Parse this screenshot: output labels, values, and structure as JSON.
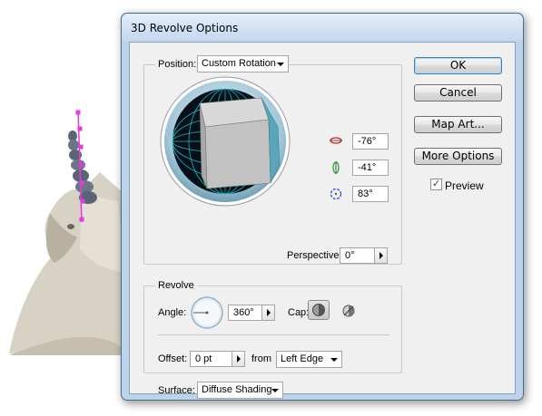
{
  "dialog": {
    "title": "3D Revolve Options",
    "position": {
      "label": "Position:",
      "value": "Custom Rotation"
    },
    "rotation": {
      "x_angle": "-76°",
      "y_angle": "-41°",
      "z_angle": "83°"
    },
    "perspective": {
      "label": "Perspective:",
      "value": "0°"
    },
    "revolve": {
      "legend": "Revolve",
      "angle_label": "Angle:",
      "angle_value": "360°",
      "cap_label": "Cap:",
      "offset_label": "Offset:",
      "offset_value": "0 pt",
      "from_label": "from",
      "from_value": "Left Edge"
    },
    "surface": {
      "label": "Surface:",
      "value": "Diffuse Shading"
    },
    "buttons": {
      "ok": "OK",
      "cancel": "Cancel",
      "map_art": "Map Art...",
      "more_options": "More Options"
    },
    "preview": {
      "label": "Preview",
      "checked": true
    }
  },
  "icons": {
    "x_axis": "x-axis-rotation-icon",
    "y_axis": "y-axis-rotation-icon",
    "z_axis": "z-axis-rotation-icon",
    "cap_on": "cap-on-icon",
    "cap_off": "cap-off-icon",
    "angle_dial": "angle-dial-icon"
  },
  "colors": {
    "dialog_frame": "#bcd3ea",
    "cube_face_side": "#5aa6b8",
    "track_grid": "#1fb6c9",
    "guide_magenta": "#e23ce0"
  }
}
